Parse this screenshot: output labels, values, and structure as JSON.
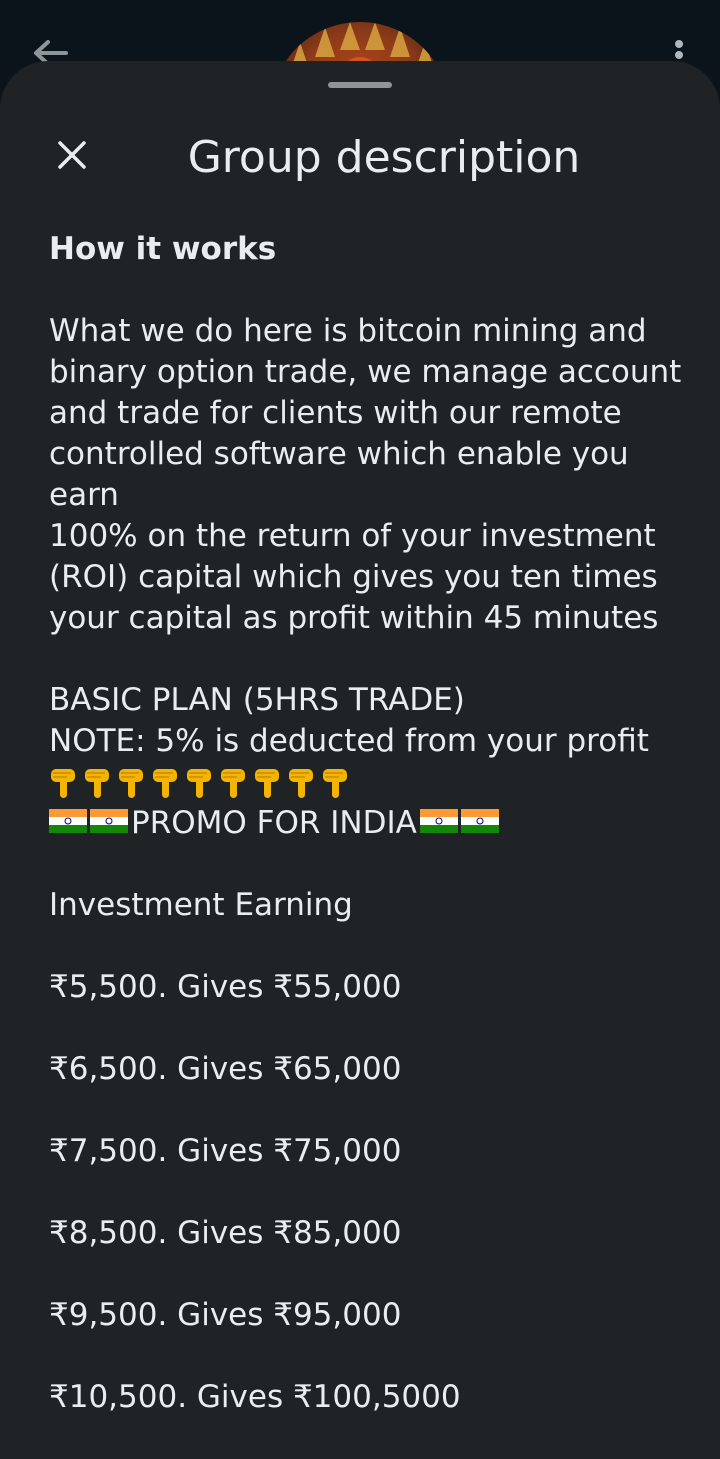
{
  "header": {
    "back_icon": "arrow-back-icon",
    "more_icon": "more-vert-icon"
  },
  "sheet": {
    "close_icon": "close-icon",
    "title": "Group description"
  },
  "description": {
    "heading": "How it works",
    "paragraph1": "What we do here is bitcoin mining and\nbinary option trade, we manage account\nand trade for clients with our remote\ncontrolled software which enable you\nearn\n100% on the return of your investment\n(ROI) capital which gives you ten times\nyour capital as profit within 45 minutes",
    "plan_title": "BASIC PLAN (5HRS TRADE)",
    "note": "NOTE: 5% is deducted from your profit",
    "emoji_icon": "backhand-index-pointing-down-icon",
    "emoji_count": 9,
    "flag_icon": "india-flag-icon",
    "promo": "PROMO FOR INDIA",
    "table_header": "Investment  Earning",
    "plans": [
      "₹5,500. Gives ₹55,000",
      "₹6,500. Gives ₹65,000",
      "₹7,500. Gives ₹75,000",
      "₹8,500. Gives ₹85,000",
      "₹9,500. Gives ₹95,000",
      "₹10,500. Gives ₹100,5000"
    ]
  }
}
